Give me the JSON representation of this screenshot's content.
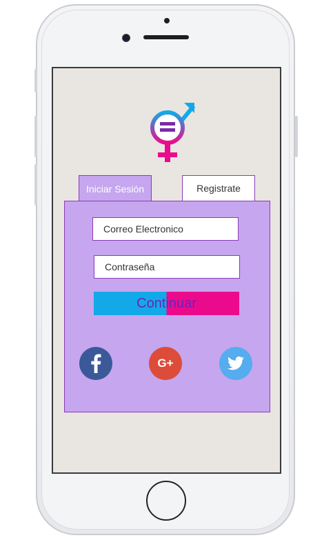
{
  "tabs": {
    "login": "Iniciar Sesión",
    "register": "Registrate"
  },
  "form": {
    "email_placeholder": "Correo Electronico",
    "password_placeholder": "Contraseña",
    "continue_label": "Continuar"
  },
  "social": {
    "google_label": "G+",
    "facebook_label": "f"
  },
  "colors": {
    "panel": "#c5a6ef",
    "screen": "#e9e5e1",
    "blue": "#13a9e8",
    "pink": "#ec0a8c",
    "purple_text": "#6a22b8",
    "facebook": "#3b5998",
    "google": "#dd4b39",
    "twitter": "#55acee"
  },
  "icons": [
    "gender-equality-logo-icon",
    "facebook-icon",
    "google-plus-icon",
    "twitter-icon"
  ]
}
